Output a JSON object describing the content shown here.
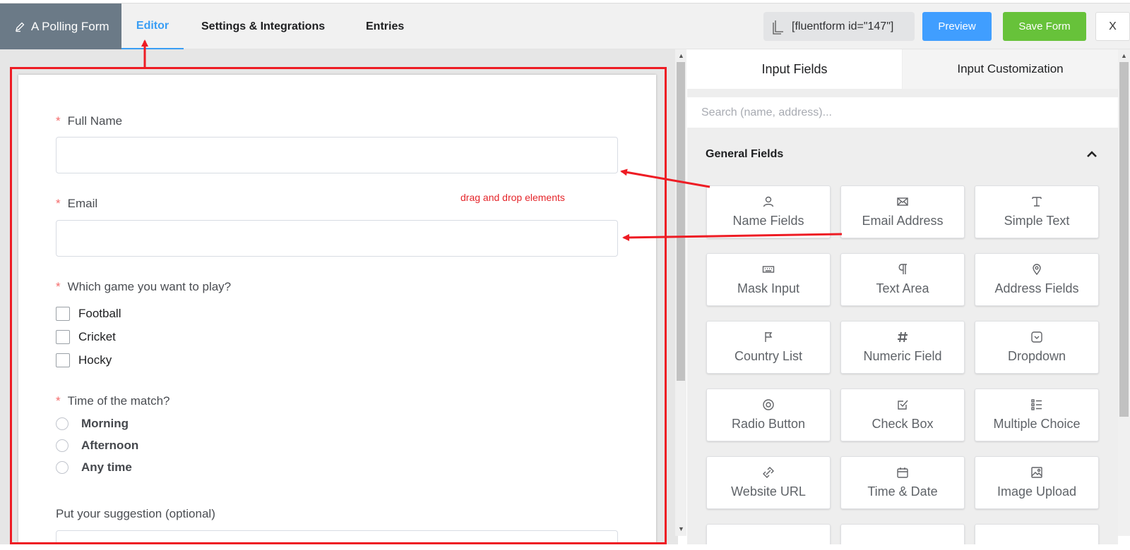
{
  "header": {
    "form_title": "A Polling Form",
    "tabs": [
      {
        "label": "Editor",
        "active": true
      },
      {
        "label": "Settings & Integrations",
        "active": false
      },
      {
        "label": "Entries",
        "active": false
      }
    ],
    "shortcode": "[fluentform id=\"147\"]",
    "preview_label": "Preview",
    "save_label": "Save Form",
    "close_label": "X"
  },
  "form": {
    "full_name": {
      "label": "Full Name",
      "required_mark": "*"
    },
    "email": {
      "label": "Email",
      "required_mark": "*"
    },
    "game": {
      "label": "Which game you want to play?",
      "required_mark": "*",
      "options": [
        "Football",
        "Cricket",
        "Hocky"
      ]
    },
    "match_time": {
      "label": "Time of the match?",
      "required_mark": "*",
      "options": [
        "Morning",
        "Afternoon",
        "Any time"
      ]
    },
    "suggestion": {
      "label": "Put your suggestion (optional)"
    }
  },
  "annotation": {
    "drag_hint": "drag and drop elements",
    "color": "#ee1c24"
  },
  "panel": {
    "tabs": [
      {
        "label": "Input Fields",
        "active": true
      },
      {
        "label": "Input Customization",
        "active": false
      }
    ],
    "search_placeholder": "Search (name, address)...",
    "section_title": "General Fields",
    "fields": [
      {
        "label": "Name Fields",
        "icon": "user-icon"
      },
      {
        "label": "Email Address",
        "icon": "envelope-icon"
      },
      {
        "label": "Simple Text",
        "icon": "text-cursor-icon"
      },
      {
        "label": "Mask Input",
        "icon": "keyboard-icon"
      },
      {
        "label": "Text Area",
        "icon": "paragraph-icon"
      },
      {
        "label": "Address Fields",
        "icon": "map-pin-icon"
      },
      {
        "label": "Country List",
        "icon": "flag-icon"
      },
      {
        "label": "Numeric Field",
        "icon": "hash-icon"
      },
      {
        "label": "Dropdown",
        "icon": "dropdown-icon"
      },
      {
        "label": "Radio Button",
        "icon": "radio-icon"
      },
      {
        "label": "Check Box",
        "icon": "checkbox-icon"
      },
      {
        "label": "Multiple Choice",
        "icon": "list-icon"
      },
      {
        "label": "Website URL",
        "icon": "link-icon"
      },
      {
        "label": "Time & Date",
        "icon": "calendar-icon"
      },
      {
        "label": "Image Upload",
        "icon": "image-icon"
      }
    ]
  },
  "colors": {
    "accent": "#409eff",
    "save": "#67c23a",
    "title_bg": "#6b7a87",
    "required": "#f56c6c"
  }
}
